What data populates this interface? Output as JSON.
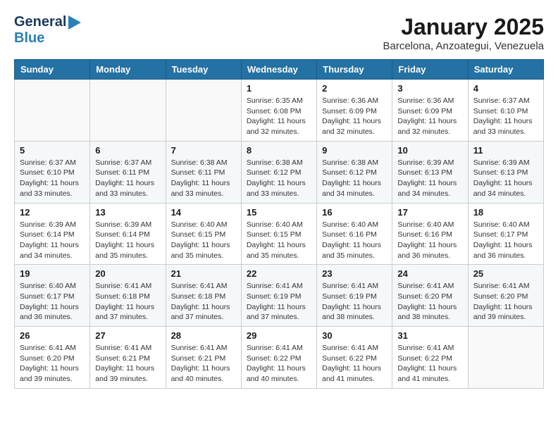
{
  "header": {
    "logo_general": "General",
    "logo_blue": "Blue",
    "month_title": "January 2025",
    "location": "Barcelona, Anzoategui, Venezuela"
  },
  "days_of_week": [
    "Sunday",
    "Monday",
    "Tuesday",
    "Wednesday",
    "Thursday",
    "Friday",
    "Saturday"
  ],
  "weeks": [
    [
      {
        "day": "",
        "info": ""
      },
      {
        "day": "",
        "info": ""
      },
      {
        "day": "",
        "info": ""
      },
      {
        "day": "1",
        "info": "Sunrise: 6:35 AM\nSunset: 6:08 PM\nDaylight: 11 hours\nand 32 minutes."
      },
      {
        "day": "2",
        "info": "Sunrise: 6:36 AM\nSunset: 6:09 PM\nDaylight: 11 hours\nand 32 minutes."
      },
      {
        "day": "3",
        "info": "Sunrise: 6:36 AM\nSunset: 6:09 PM\nDaylight: 11 hours\nand 32 minutes."
      },
      {
        "day": "4",
        "info": "Sunrise: 6:37 AM\nSunset: 6:10 PM\nDaylight: 11 hours\nand 33 minutes."
      }
    ],
    [
      {
        "day": "5",
        "info": "Sunrise: 6:37 AM\nSunset: 6:10 PM\nDaylight: 11 hours\nand 33 minutes."
      },
      {
        "day": "6",
        "info": "Sunrise: 6:37 AM\nSunset: 6:11 PM\nDaylight: 11 hours\nand 33 minutes."
      },
      {
        "day": "7",
        "info": "Sunrise: 6:38 AM\nSunset: 6:11 PM\nDaylight: 11 hours\nand 33 minutes."
      },
      {
        "day": "8",
        "info": "Sunrise: 6:38 AM\nSunset: 6:12 PM\nDaylight: 11 hours\nand 33 minutes."
      },
      {
        "day": "9",
        "info": "Sunrise: 6:38 AM\nSunset: 6:12 PM\nDaylight: 11 hours\nand 34 minutes."
      },
      {
        "day": "10",
        "info": "Sunrise: 6:39 AM\nSunset: 6:13 PM\nDaylight: 11 hours\nand 34 minutes."
      },
      {
        "day": "11",
        "info": "Sunrise: 6:39 AM\nSunset: 6:13 PM\nDaylight: 11 hours\nand 34 minutes."
      }
    ],
    [
      {
        "day": "12",
        "info": "Sunrise: 6:39 AM\nSunset: 6:14 PM\nDaylight: 11 hours\nand 34 minutes."
      },
      {
        "day": "13",
        "info": "Sunrise: 6:39 AM\nSunset: 6:14 PM\nDaylight: 11 hours\nand 35 minutes."
      },
      {
        "day": "14",
        "info": "Sunrise: 6:40 AM\nSunset: 6:15 PM\nDaylight: 11 hours\nand 35 minutes."
      },
      {
        "day": "15",
        "info": "Sunrise: 6:40 AM\nSunset: 6:15 PM\nDaylight: 11 hours\nand 35 minutes."
      },
      {
        "day": "16",
        "info": "Sunrise: 6:40 AM\nSunset: 6:16 PM\nDaylight: 11 hours\nand 35 minutes."
      },
      {
        "day": "17",
        "info": "Sunrise: 6:40 AM\nSunset: 6:16 PM\nDaylight: 11 hours\nand 36 minutes."
      },
      {
        "day": "18",
        "info": "Sunrise: 6:40 AM\nSunset: 6:17 PM\nDaylight: 11 hours\nand 36 minutes."
      }
    ],
    [
      {
        "day": "19",
        "info": "Sunrise: 6:40 AM\nSunset: 6:17 PM\nDaylight: 11 hours\nand 36 minutes."
      },
      {
        "day": "20",
        "info": "Sunrise: 6:41 AM\nSunset: 6:18 PM\nDaylight: 11 hours\nand 37 minutes."
      },
      {
        "day": "21",
        "info": "Sunrise: 6:41 AM\nSunset: 6:18 PM\nDaylight: 11 hours\nand 37 minutes."
      },
      {
        "day": "22",
        "info": "Sunrise: 6:41 AM\nSunset: 6:19 PM\nDaylight: 11 hours\nand 37 minutes."
      },
      {
        "day": "23",
        "info": "Sunrise: 6:41 AM\nSunset: 6:19 PM\nDaylight: 11 hours\nand 38 minutes."
      },
      {
        "day": "24",
        "info": "Sunrise: 6:41 AM\nSunset: 6:20 PM\nDaylight: 11 hours\nand 38 minutes."
      },
      {
        "day": "25",
        "info": "Sunrise: 6:41 AM\nSunset: 6:20 PM\nDaylight: 11 hours\nand 39 minutes."
      }
    ],
    [
      {
        "day": "26",
        "info": "Sunrise: 6:41 AM\nSunset: 6:20 PM\nDaylight: 11 hours\nand 39 minutes."
      },
      {
        "day": "27",
        "info": "Sunrise: 6:41 AM\nSunset: 6:21 PM\nDaylight: 11 hours\nand 39 minutes."
      },
      {
        "day": "28",
        "info": "Sunrise: 6:41 AM\nSunset: 6:21 PM\nDaylight: 11 hours\nand 40 minutes."
      },
      {
        "day": "29",
        "info": "Sunrise: 6:41 AM\nSunset: 6:22 PM\nDaylight: 11 hours\nand 40 minutes."
      },
      {
        "day": "30",
        "info": "Sunrise: 6:41 AM\nSunset: 6:22 PM\nDaylight: 11 hours\nand 41 minutes."
      },
      {
        "day": "31",
        "info": "Sunrise: 6:41 AM\nSunset: 6:22 PM\nDaylight: 11 hours\nand 41 minutes."
      },
      {
        "day": "",
        "info": ""
      }
    ]
  ]
}
